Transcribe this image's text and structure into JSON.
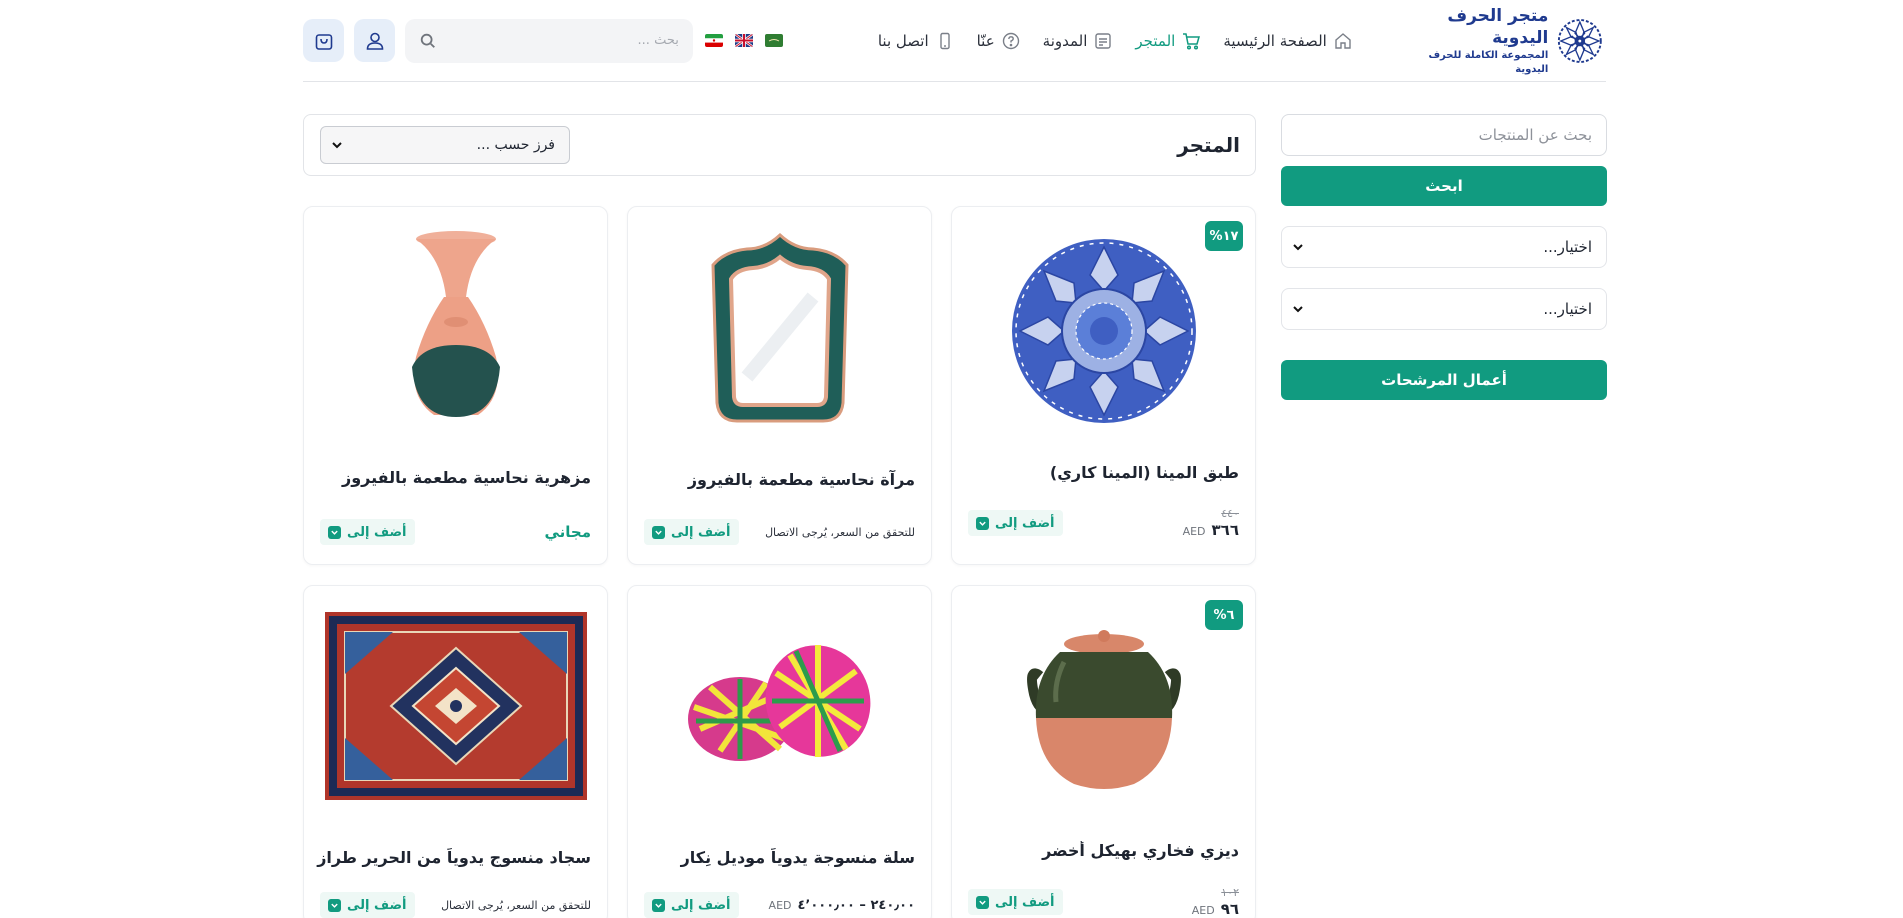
{
  "header": {
    "brand_title": "متجر الحرف اليدوية",
    "brand_subtitle": "المجموعة الكاملة للحرف اليدوية",
    "nav": [
      {
        "label": "الصفحة الرئيسية",
        "icon": "home-icon",
        "active": false
      },
      {
        "label": "المتجر",
        "icon": "cart-icon",
        "active": true
      },
      {
        "label": "المدونة",
        "icon": "blog-icon",
        "active": false
      },
      {
        "label": "عنّا",
        "icon": "question-icon",
        "active": false
      },
      {
        "label": "اتصل بنا",
        "icon": "phone-icon",
        "active": false
      }
    ],
    "languages": [
      "ar",
      "en",
      "fa"
    ],
    "search_placeholder": "بحث ..."
  },
  "sidebar": {
    "search_placeholder": "بحث عن المنتجات",
    "search_button": "ابحث",
    "select_1": "اختيار...",
    "select_2": "اختيار...",
    "apply_button": "أعمال المرشحات"
  },
  "shop": {
    "title": "المتجر",
    "sort_label": "فرز حسب ..."
  },
  "products": [
    {
      "title": "طبق المينا (المينا كاري)",
      "badge": "١٧%",
      "old_price": "٤٤٠",
      "price": "٣٦٦",
      "currency": "AED",
      "add_label": "أضف إلى"
    },
    {
      "title": "مرآة نحاسية مطعمة بالفيروز",
      "price_note": "للتحقق من السعر، يُرجى الاتصال",
      "add_label": "أضف إلى"
    },
    {
      "title": "مزهرية نحاسية مطعمة بالفيروز",
      "free_label": "مجاني",
      "add_label": "أضف إلى"
    },
    {
      "title": "ديزي فخاري بهيكل أخضر",
      "badge": "٦%",
      "old_price": "١٠٢",
      "price": "٩٦",
      "currency": "AED",
      "add_label": "أضف إلى"
    },
    {
      "title": "سلة منسوجة يدوياً موديل نِكار",
      "price_range": "٢٤٠٫٠٠ – ٤٬٠٠٠٫٠٠",
      "currency": "AED",
      "add_label": "أضف إلى"
    },
    {
      "title": "سجاد منسوج يدوياً من الحرير طراز كيهان",
      "price_note": "للتحقق من السعر، يُرجى الاتصال",
      "add_label": "أضف إلى"
    }
  ],
  "colors": {
    "accent": "#119b80",
    "brand": "#1f3a8f",
    "icon_button_bg": "#e6eef9"
  }
}
